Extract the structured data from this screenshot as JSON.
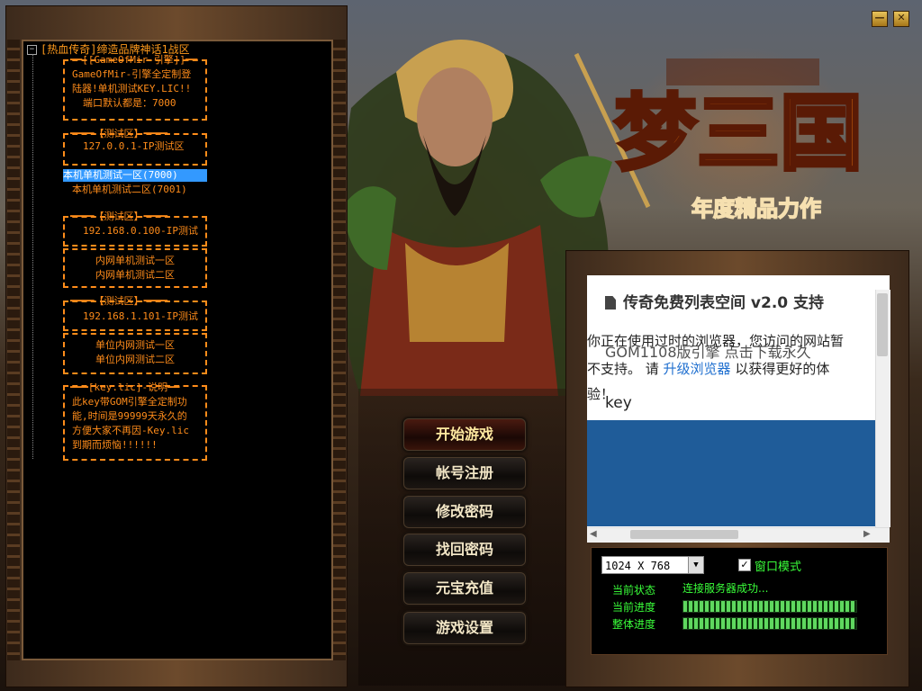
{
  "tree": {
    "root_label": "[热血传奇]缔造品牌神话1战区",
    "nodes": [
      "━━[[GameOfMir-引擎]]━━",
      "GameOfMir-引擎全定制登",
      "陆器!单机测试KEY.LIC!!",
      "端口默认都是：7000",
      "━━━━【测试区】━━━━",
      "127.0.0.1-IP测试区",
      "本机单机测试一区(7000)",
      "本机单机测试二区(7001)",
      "━━━━【测试区】━━━━",
      "192.168.0.100-IP测试",
      "内网单机测试一区",
      "内网单机测试二区",
      "━━━━【测试区】━━━━",
      "192.168.1.101-IP测试",
      "单位内网测试一区",
      "单位内网测试二区",
      "━━━[key.lic]-说明━━",
      "此key带GOM引擎全定制功",
      "能,时间是99999天永久的",
      "方便大家不再因-Key.lic",
      "到期而烦恼!!!!!!"
    ]
  },
  "logo": {
    "title": "梦三国",
    "subtitle": "年度精品力作"
  },
  "window_controls": {
    "minimize": "—",
    "close": "✕"
  },
  "menu": {
    "start": "开始游戏",
    "register": "帐号注册",
    "change_password": "修改密码",
    "recover_password": "找回密码",
    "recharge": "元宝充值",
    "settings": "游戏设置"
  },
  "browser": {
    "title": "传奇免费列表空间 v2.0 支持",
    "notice_line1": "你正在使用过时的浏览器，您访问的网站暂",
    "notice_line2_pre": "不支持。 请 ",
    "notice_link": "升级浏览器",
    "notice_line2_post": " 以获得更好的体",
    "notice_line3": "验！",
    "overlay": "GOM1108版引擎 点击下载永久",
    "key": "key",
    "scroll_left": "◀",
    "scroll_right": "▶"
  },
  "controls": {
    "resolution": "1024 X 768",
    "window_mode_checked": "✓",
    "window_mode_label": "窗口模式",
    "status_label": "当前状态",
    "status_value": "连接服务器成功...",
    "progress_label": "当前进度",
    "total_label": "整体进度",
    "progress_fraction": 0.99,
    "total_fraction": 0.99
  },
  "colors": {
    "tree_text": "#ff8c1a",
    "status_green": "#3aff3a",
    "selection": "#3399ff"
  }
}
